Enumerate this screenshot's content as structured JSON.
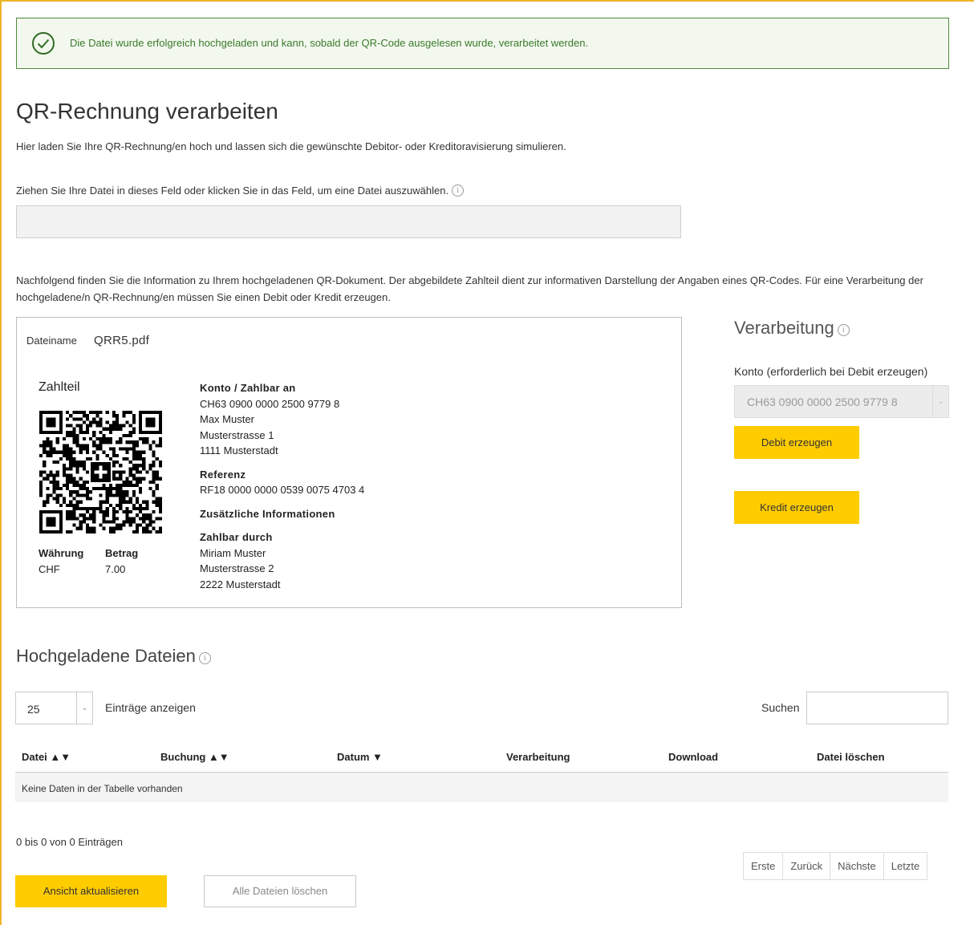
{
  "alert": {
    "icon": "check-circle-icon",
    "message": "Die Datei wurde erfolgreich hochgeladen und kann, sobald der QR-Code ausgelesen wurde, verarbeitet werden."
  },
  "page": {
    "title": "QR-Rechnung verarbeiten",
    "intro": "Hier laden Sie Ihre QR-Rechnung/en hoch und lassen sich die gewünschte Debitor- oder Kreditoravisierung simulieren.",
    "drop_label": "Ziehen Sie Ihre Datei in dieses Feld oder klicken Sie in das Feld, um eine Datei auszuwählen.",
    "info_text": "Nachfolgend finden Sie die Information zu Ihrem hochgeladenen QR-Dokument. Der abgebildete Zahlteil dient zur informativen Darstellung der Angaben eines QR-Codes. Für eine Verarbeitung der hochgeladene/n QR-Rechnung/en müssen Sie einen Debit oder Kredit erzeugen."
  },
  "receipt": {
    "filename_label": "Dateiname",
    "filename": "QRR5.pdf",
    "section_title": "Zahlteil",
    "currency_label": "Währung",
    "amount_label": "Betrag",
    "currency": "CHF",
    "amount": "7.00",
    "account_heading": "Konto / Zahlbar an",
    "account_iban": "CH63 0900 0000 2500 9779 8",
    "payee_name": "Max Muster",
    "payee_street": "Musterstrasse 1",
    "payee_city": "1111 Musterstadt",
    "reference_heading": "Referenz",
    "reference": "RF18 0000 0000 0539 0075 4703 4",
    "additional_heading": "Zusätzliche Informationen",
    "payer_heading": "Zahlbar durch",
    "payer_name": "Miriam Muster",
    "payer_street": "Musterstrasse 2",
    "payer_city": "2222 Musterstadt"
  },
  "processing": {
    "title": "Verarbeitung",
    "konto_label": "Konto (erforderlich bei Debit erzeugen)",
    "konto_value": "CH63 0900 0000 2500 9779 8",
    "debit_button": "Debit erzeugen",
    "credit_button": "Kredit erzeugen"
  },
  "files": {
    "title": "Hochgeladene Dateien",
    "page_length": "25",
    "page_length_label": "Einträge anzeigen",
    "search_label": "Suchen",
    "search_value": "",
    "columns": [
      "Datei ▲▼",
      "Buchung ▲▼",
      "Datum ▼",
      "Verarbeitung",
      "Download",
      "Datei löschen"
    ],
    "empty_message": "Keine Daten in der Tabelle vorhanden",
    "count_info": "0 bis 0 von 0 Einträgen",
    "pager": [
      "Erste",
      "Zurück",
      "Nächste",
      "Letzte"
    ],
    "refresh_button": "Ansicht aktualisieren",
    "delete_all_button": "Alle Dateien löschen"
  },
  "colors": {
    "accent": "#ffcc00",
    "success": "#4f8a3c",
    "frame": "#f0b429"
  }
}
